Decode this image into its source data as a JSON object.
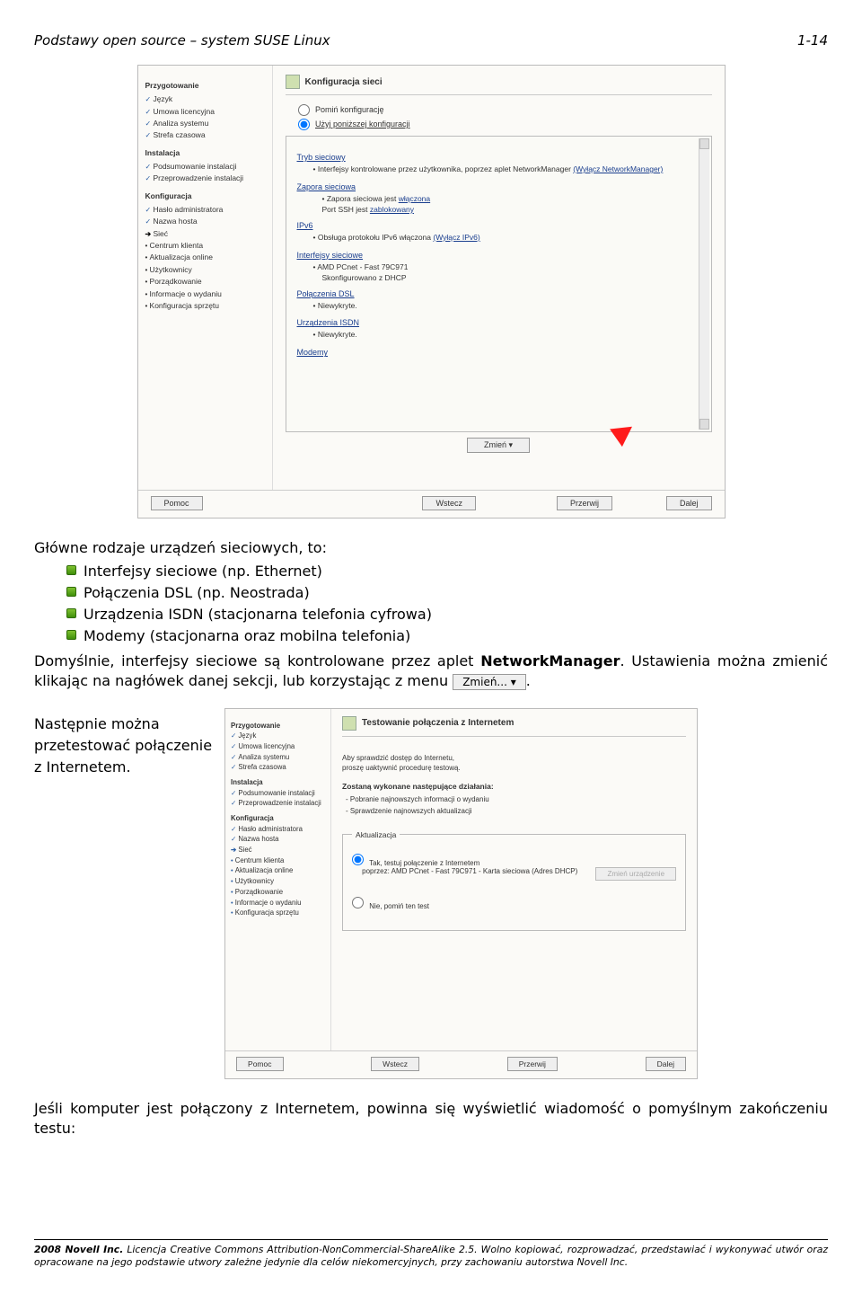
{
  "header": {
    "title_left": "Podstawy open  source – system SUSE Linux",
    "title_right": "1-14"
  },
  "shot1": {
    "left_panel": {
      "group1_title": "Przygotowanie",
      "group1": [
        "Język",
        "Umowa licencyjna",
        "Analiza systemu",
        "Strefa czasowa"
      ],
      "group2_title": "Instalacja",
      "group2": [
        "Podsumowanie instalacji",
        "Przeprowadzenie instalacji"
      ],
      "group3_title": "Konfiguracja",
      "group3_check": [
        "Hasło administratora",
        "Nazwa hosta"
      ],
      "group3_current": "Sieć",
      "group3_dots": [
        "Centrum klienta",
        "Aktualizacja online",
        "Użytkownicy",
        "Porządkowanie",
        "Informacje o wydaniu",
        "Konfiguracja sprzętu"
      ]
    },
    "pane_title": "Konfiguracja sieci",
    "radio1": "Pomiń konfigurację",
    "radio2": "Użyj poniższej konfiguracji",
    "sections": {
      "s1_title": "Tryb sieciowy",
      "s1_item": "Interfejsy kontrolowane przez użytkownika, poprzez aplet NetworkManager",
      "s1_link": "(Wyłącz NetworkManager)",
      "s2_title": "Zapora sieciowa",
      "s2_a": "Zapora sieciowa jest ",
      "s2_a_lnk": "włączona",
      "s2_b": "Port SSH jest ",
      "s2_b_lnk": "zablokowany",
      "s3_title": "IPv6",
      "s3_item": "Obsługa protokołu IPv6 włączona ",
      "s3_lnk": "(Wyłącz IPv6)",
      "s4_title": "Interfejsy sieciowe",
      "s4_a": "AMD PCnet - Fast 79C971",
      "s4_b": "Skonfigurowano z DHCP",
      "s5_title": "Połączenia DSL",
      "s5_item": "Niewykryte.",
      "s6_title": "Urządzenia ISDN",
      "s6_item": "Niewykryte.",
      "s7_title": "Modemy"
    },
    "zmien_btn": "Zmień    ▾",
    "foot": {
      "pomoc": "Pomoc",
      "wstecz": "Wstecz",
      "przerwij": "Przerwij",
      "dalej": "Dalej"
    }
  },
  "text": {
    "line1": "Główne rodzaje urządzeń sieciowych, to:",
    "b1": "Interfejsy sieciowe (np. Ethernet)",
    "b2": "Połączenia DSL (np. Neostrada)",
    "b3": "Urządzenia ISDN (stacjonarna telefonia cyfrowa)",
    "b4": "Modemy (stacjonarna oraz mobilna telefonia)",
    "para2a": "Domyślnie, interfejsy sieciowe są kontrolowane przez aplet ",
    "para2b_bold": "NetworkManager",
    "para2c": ". Ustawienia można zmienić klikając na nagłówek danej sekcji, lub korzystając z menu ",
    "zmien_inline": "Zmień...  ▾",
    "para2d": ".",
    "left_col_1": "Następnie można",
    "left_col_2": "przetestować połączenie",
    "left_col_3": " z Internetem.",
    "bottom_para": "Jeśli komputer jest połączony z Internetem, powinna się wyświetlić wiadomość o pomyślnym zakończeniu testu:"
  },
  "shot2": {
    "left_panel": {
      "group1_title": "Przygotowanie",
      "group1": [
        "Język",
        "Umowa licencyjna",
        "Analiza systemu",
        "Strefa czasowa"
      ],
      "group2_title": "Instalacja",
      "group2": [
        "Podsumowanie instalacji",
        "Przeprowadzenie instalacji"
      ],
      "group3_title": "Konfiguracja",
      "group3_check": [
        "Hasło administratora",
        "Nazwa hosta"
      ],
      "group3_current": "Sieć",
      "group3_dots": [
        "Centrum klienta",
        "Aktualizacja online",
        "Użytkownicy",
        "Porządkowanie",
        "Informacje o wydaniu",
        "Konfiguracja sprzętu"
      ]
    },
    "pane_title": "Testowanie połączenia z Internetem",
    "msg1": "Aby sprawdzić dostęp do Internetu,",
    "msg2": "proszę uaktywnić procedurę testową.",
    "subhead": "Zostaną wykonane następujące działania:",
    "lst1": "- Pobranie najnowszych informacji o wydaniu",
    "lst2": "- Sprawdzenie najnowszych aktualizacji",
    "fieldset_legend": "Aktualizacja",
    "r1a": "Tak, testuj połączenie z Internetem",
    "r1b": "poprzez: AMD PCnet - Fast 79C971 - Karta sieciowa (Adres DHCP)",
    "greybtn": "Zmień urządzenie",
    "r2": "Nie, pomiń ten test",
    "foot": {
      "pomoc": "Pomoc",
      "wstecz": "Wstecz",
      "przerwij": "Przerwij",
      "dalej": "Dalej"
    }
  },
  "footer": {
    "line": "2008 Novell Inc. Licencja Creative Commons Attribution-NonCommercial-ShareAlike 2.5. Wolno kopiować, rozprowadzać, przedstawiać i wykonywać utwór oraz opracowane na jego podstawie utwory zależne jedynie dla celów niekomercyjnych, przy zachowaniu autorstwa Novell Inc.",
    "bold_prefix": "2008 Novell Inc."
  }
}
